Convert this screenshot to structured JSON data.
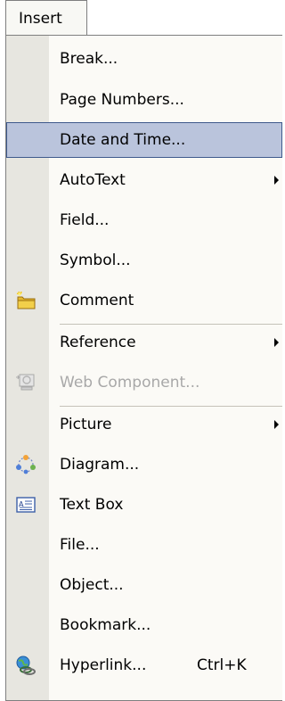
{
  "menu_tab": {
    "label": "Insert"
  },
  "items": [
    {
      "label": "Break..."
    },
    {
      "label": "Page Numbers..."
    },
    {
      "label": "Date and Time..."
    },
    {
      "label": "AutoText"
    },
    {
      "label": "Field..."
    },
    {
      "label": "Symbol..."
    },
    {
      "label": "Comment"
    },
    {
      "label": "Reference"
    },
    {
      "label": "Web Component..."
    },
    {
      "label": "Picture"
    },
    {
      "label": "Diagram..."
    },
    {
      "label": "Text Box"
    },
    {
      "label": "File..."
    },
    {
      "label": "Object..."
    },
    {
      "label": "Bookmark..."
    },
    {
      "label": "Hyperlink...",
      "shortcut": "Ctrl+K"
    }
  ],
  "highlighted_item": "Date and Time...",
  "disabled_item": "Web Component...",
  "submenu_items": [
    "AutoText",
    "Reference",
    "Picture"
  ],
  "icons": {
    "Comment": "comment-icon",
    "Web Component...": "web-component-icon",
    "Diagram...": "diagram-icon",
    "Text Box": "text-box-icon",
    "Hyperlink...": "hyperlink-icon"
  },
  "colors": {
    "highlight_fill": "#bac4dc",
    "highlight_border": "#3f5a8c",
    "gutter": "#e7e6e0",
    "menu_background": "#fbfaf6",
    "disabled_text": "#a8a8a8"
  }
}
